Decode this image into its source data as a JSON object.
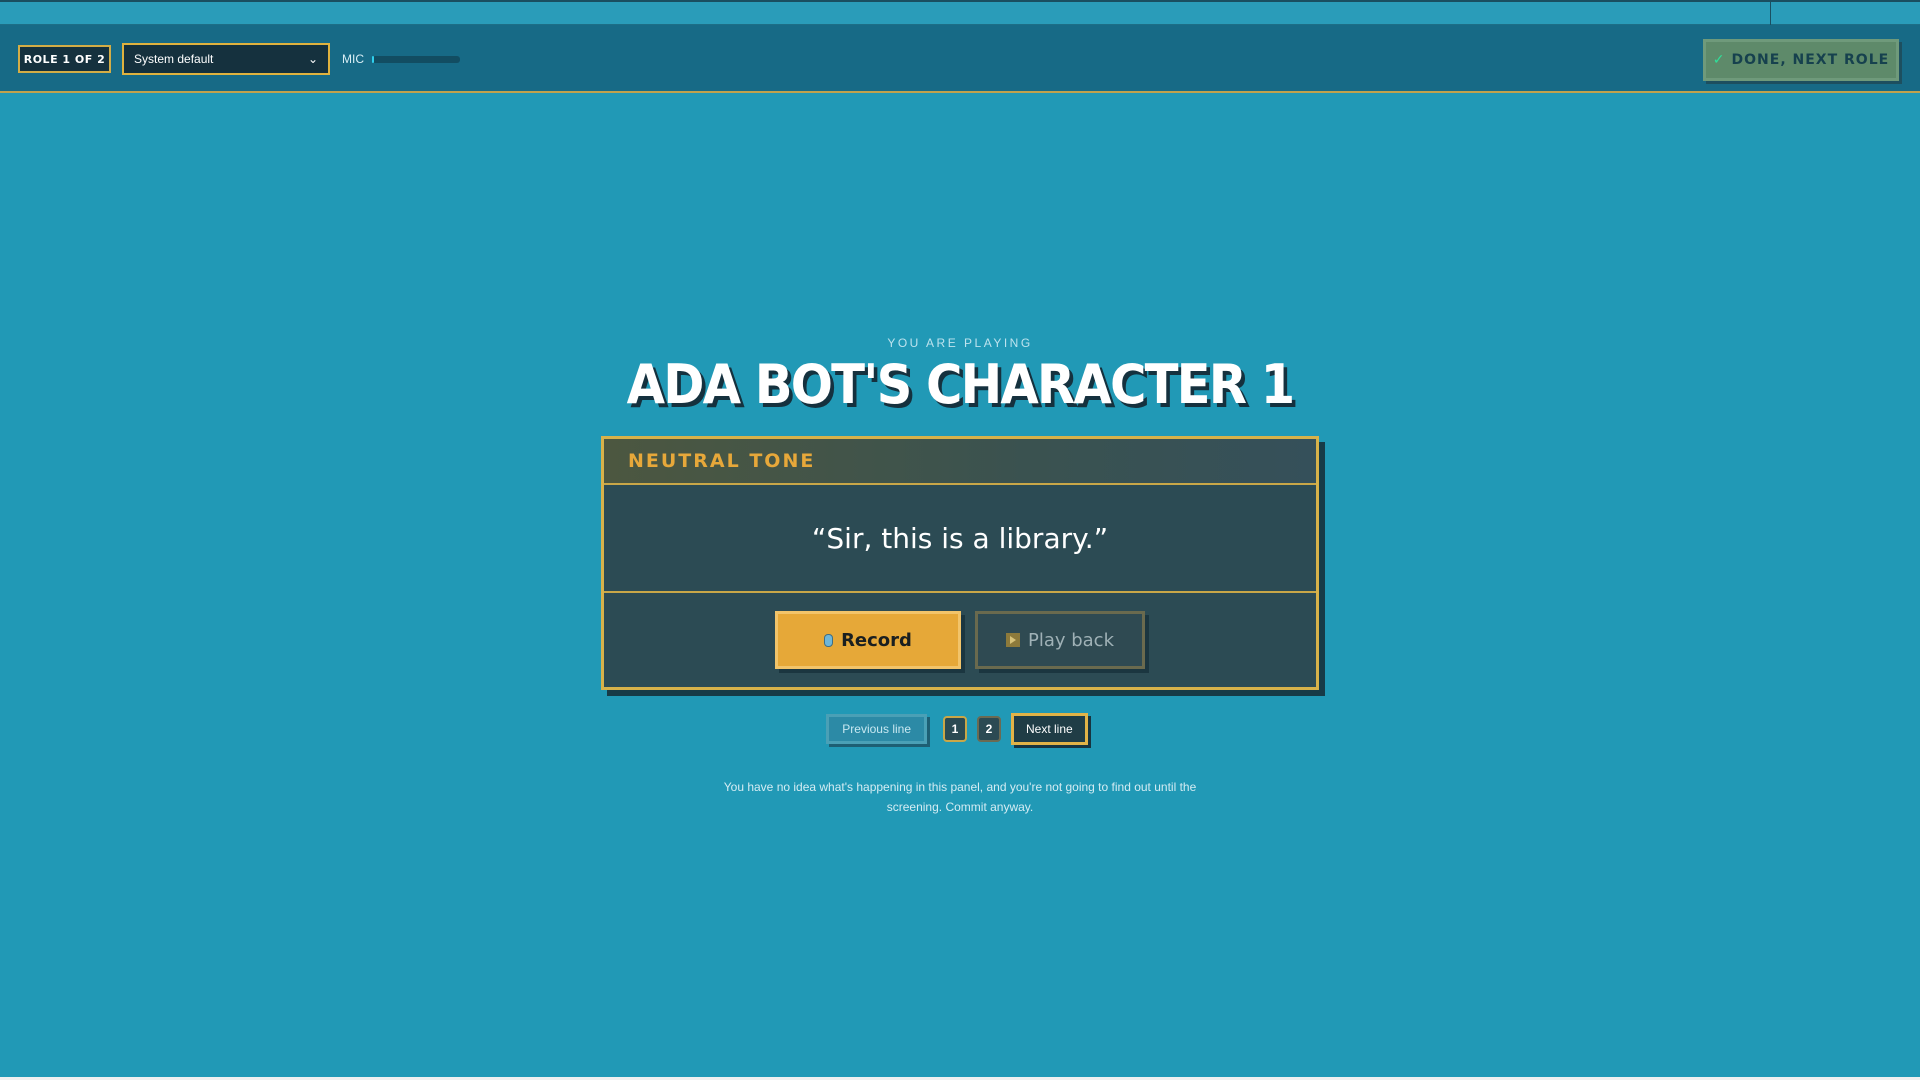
{
  "colors": {
    "background": "#2199b6",
    "toolbar": "#176a86",
    "accent_gold": "#e6a838",
    "card": "#2c4b54",
    "done_green": "#5e8a6a"
  },
  "toolbar": {
    "role_badge": "ROLE 1 OF 2",
    "device_select": {
      "value": "System default",
      "icon": "chevron-down-icon"
    },
    "mic_label": "MIC",
    "mic_level": 0.02,
    "done_button": {
      "label": "DONE, NEXT ROLE",
      "icon": "check-icon"
    }
  },
  "main": {
    "eyebrow": "YOU ARE PLAYING",
    "character_name": "ADA BOT'S CHARACTER 1",
    "card": {
      "tone": "NEUTRAL TONE",
      "line": "“Sir, this is a library.”",
      "record_label": "Record",
      "record_icon": "microphone-icon",
      "playback_label": "Play back",
      "playback_icon": "play-icon"
    },
    "pager": {
      "prev_label": "Previous line",
      "pages": [
        "1",
        "2"
      ],
      "current_page": "1",
      "next_label": "Next line"
    },
    "hint": "You have no idea what's happening in this panel, and you're not going to find out until the screening. Commit anyway."
  }
}
